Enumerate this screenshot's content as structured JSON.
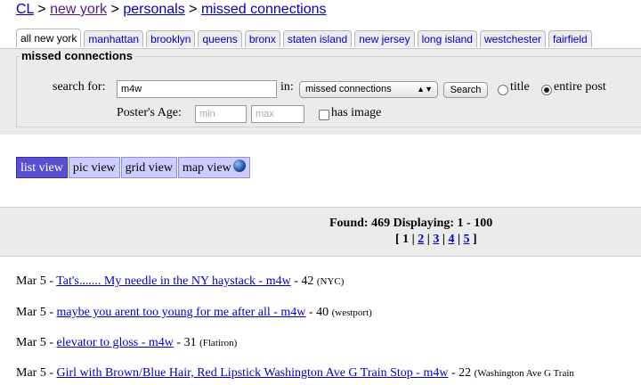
{
  "breadcrumb": {
    "root": "CL",
    "city": "new york",
    "section": "personals",
    "category": "missed connections"
  },
  "tabs": [
    "all new york",
    "manhattan",
    "brooklyn",
    "queens",
    "bronx",
    "staten island",
    "new jersey",
    "long island",
    "westchester",
    "fairfield"
  ],
  "search": {
    "legend": "missed connections",
    "search_for_label": "search for:",
    "query": "m4w",
    "in_label": "in:",
    "category_selected": "missed connections",
    "button": "Search",
    "radio_title": "title",
    "radio_entire": "entire post",
    "age_label": "Poster's Age:",
    "min_placeholder": "min",
    "max_placeholder": "max",
    "has_image": "has image"
  },
  "views": {
    "list": "list view",
    "pic": "pic view",
    "grid": "grid view",
    "map": "map view"
  },
  "results": {
    "found_text": "Found: 469 Displaying: 1 - 100",
    "pages": [
      "1",
      "2",
      "3",
      "4",
      "5"
    ]
  },
  "listings": [
    {
      "date": "Mar 5 - ",
      "title": "Tat's....... My needle in the NY haystack - m4w",
      "age": " - 42 ",
      "location": "(NYC)"
    },
    {
      "date": "Mar 5 - ",
      "title": "maybe you arent too young for me after all - m4w",
      "age": " - 40 ",
      "location": "(westport)"
    },
    {
      "date": "Mar 5 - ",
      "title": "elevator to gloss - m4w",
      "age": " - 31 ",
      "location": "(Flatiron)"
    },
    {
      "date": "Mar 5 - ",
      "title": "Girl with Brown/Blue Hair, Red Lipstick Washington Ave G Train Stop - m4w",
      "age": " - 22 ",
      "location": "(Washington Ave G Train"
    }
  ]
}
